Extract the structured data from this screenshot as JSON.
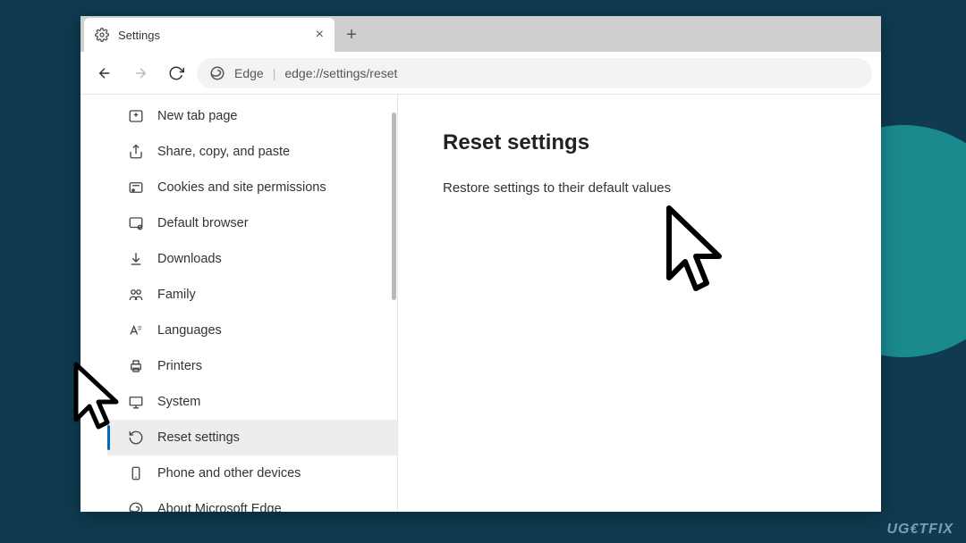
{
  "tab": {
    "title": "Settings"
  },
  "toolbar": {
    "edge_label": "Edge",
    "url": "edge://settings/reset"
  },
  "sidebar": {
    "items": [
      {
        "label": "New tab page",
        "icon": "newtab"
      },
      {
        "label": "Share, copy, and paste",
        "icon": "share"
      },
      {
        "label": "Cookies and site permissions",
        "icon": "cookies"
      },
      {
        "label": "Default browser",
        "icon": "default"
      },
      {
        "label": "Downloads",
        "icon": "download"
      },
      {
        "label": "Family",
        "icon": "family"
      },
      {
        "label": "Languages",
        "icon": "language"
      },
      {
        "label": "Printers",
        "icon": "printer"
      },
      {
        "label": "System",
        "icon": "system"
      },
      {
        "label": "Reset settings",
        "icon": "reset",
        "selected": true
      },
      {
        "label": "Phone and other devices",
        "icon": "phone"
      },
      {
        "label": "About Microsoft Edge",
        "icon": "edge"
      }
    ]
  },
  "main": {
    "heading": "Reset settings",
    "option": "Restore settings to their default values"
  },
  "watermark": "UG€TFIX"
}
